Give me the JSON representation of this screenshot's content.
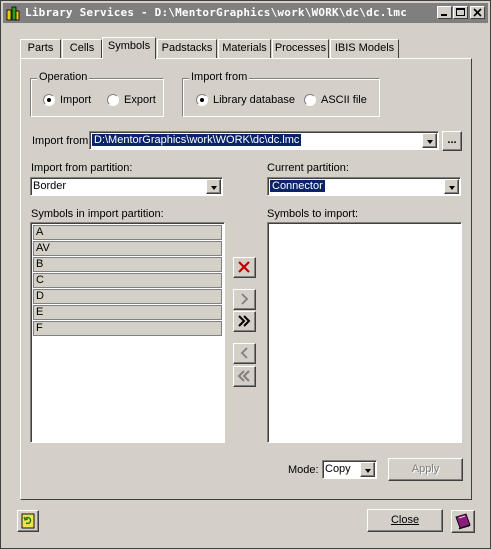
{
  "window": {
    "title": "Library Services - D:\\MentorGraphics\\work\\WORK\\dc\\dc.lmc",
    "controls": [
      "minimize",
      "maximize",
      "close"
    ]
  },
  "tabs": [
    "Parts",
    "Cells",
    "Symbols",
    "Padstacks",
    "Materials",
    "Processes",
    "IBIS Models"
  ],
  "active_tab": "Symbols",
  "operation": {
    "label": "Operation",
    "options": [
      "Import",
      "Export"
    ],
    "selected": "Import"
  },
  "import_source": {
    "label": "Import from",
    "options": [
      "Library database",
      "ASCII file"
    ],
    "selected": "Library database"
  },
  "import_path": {
    "label": "Import from:",
    "value": "D:\\MentorGraphics\\work\\WORK\\dc\\dc.lmc",
    "browse_label": "..."
  },
  "import_partition": {
    "label": "Import from partition:",
    "value": "Border"
  },
  "current_partition": {
    "label": "Current partition:",
    "value": "Connector"
  },
  "symbols_list": {
    "label": "Symbols in import partition:",
    "items": [
      "A",
      "AV",
      "B",
      "C",
      "D",
      "E",
      "F"
    ]
  },
  "import_list": {
    "label": "Symbols to import:",
    "items": []
  },
  "mode": {
    "label": "Mode:",
    "value": "Copy"
  },
  "buttons": {
    "apply": "Apply",
    "close": "Close"
  },
  "icons": {
    "delete": "red-x-icon",
    "add": "chevron-right-icon",
    "add_all": "double-chevron-right-icon",
    "remove": "chevron-left-icon",
    "remove_all": "double-chevron-left-icon"
  }
}
